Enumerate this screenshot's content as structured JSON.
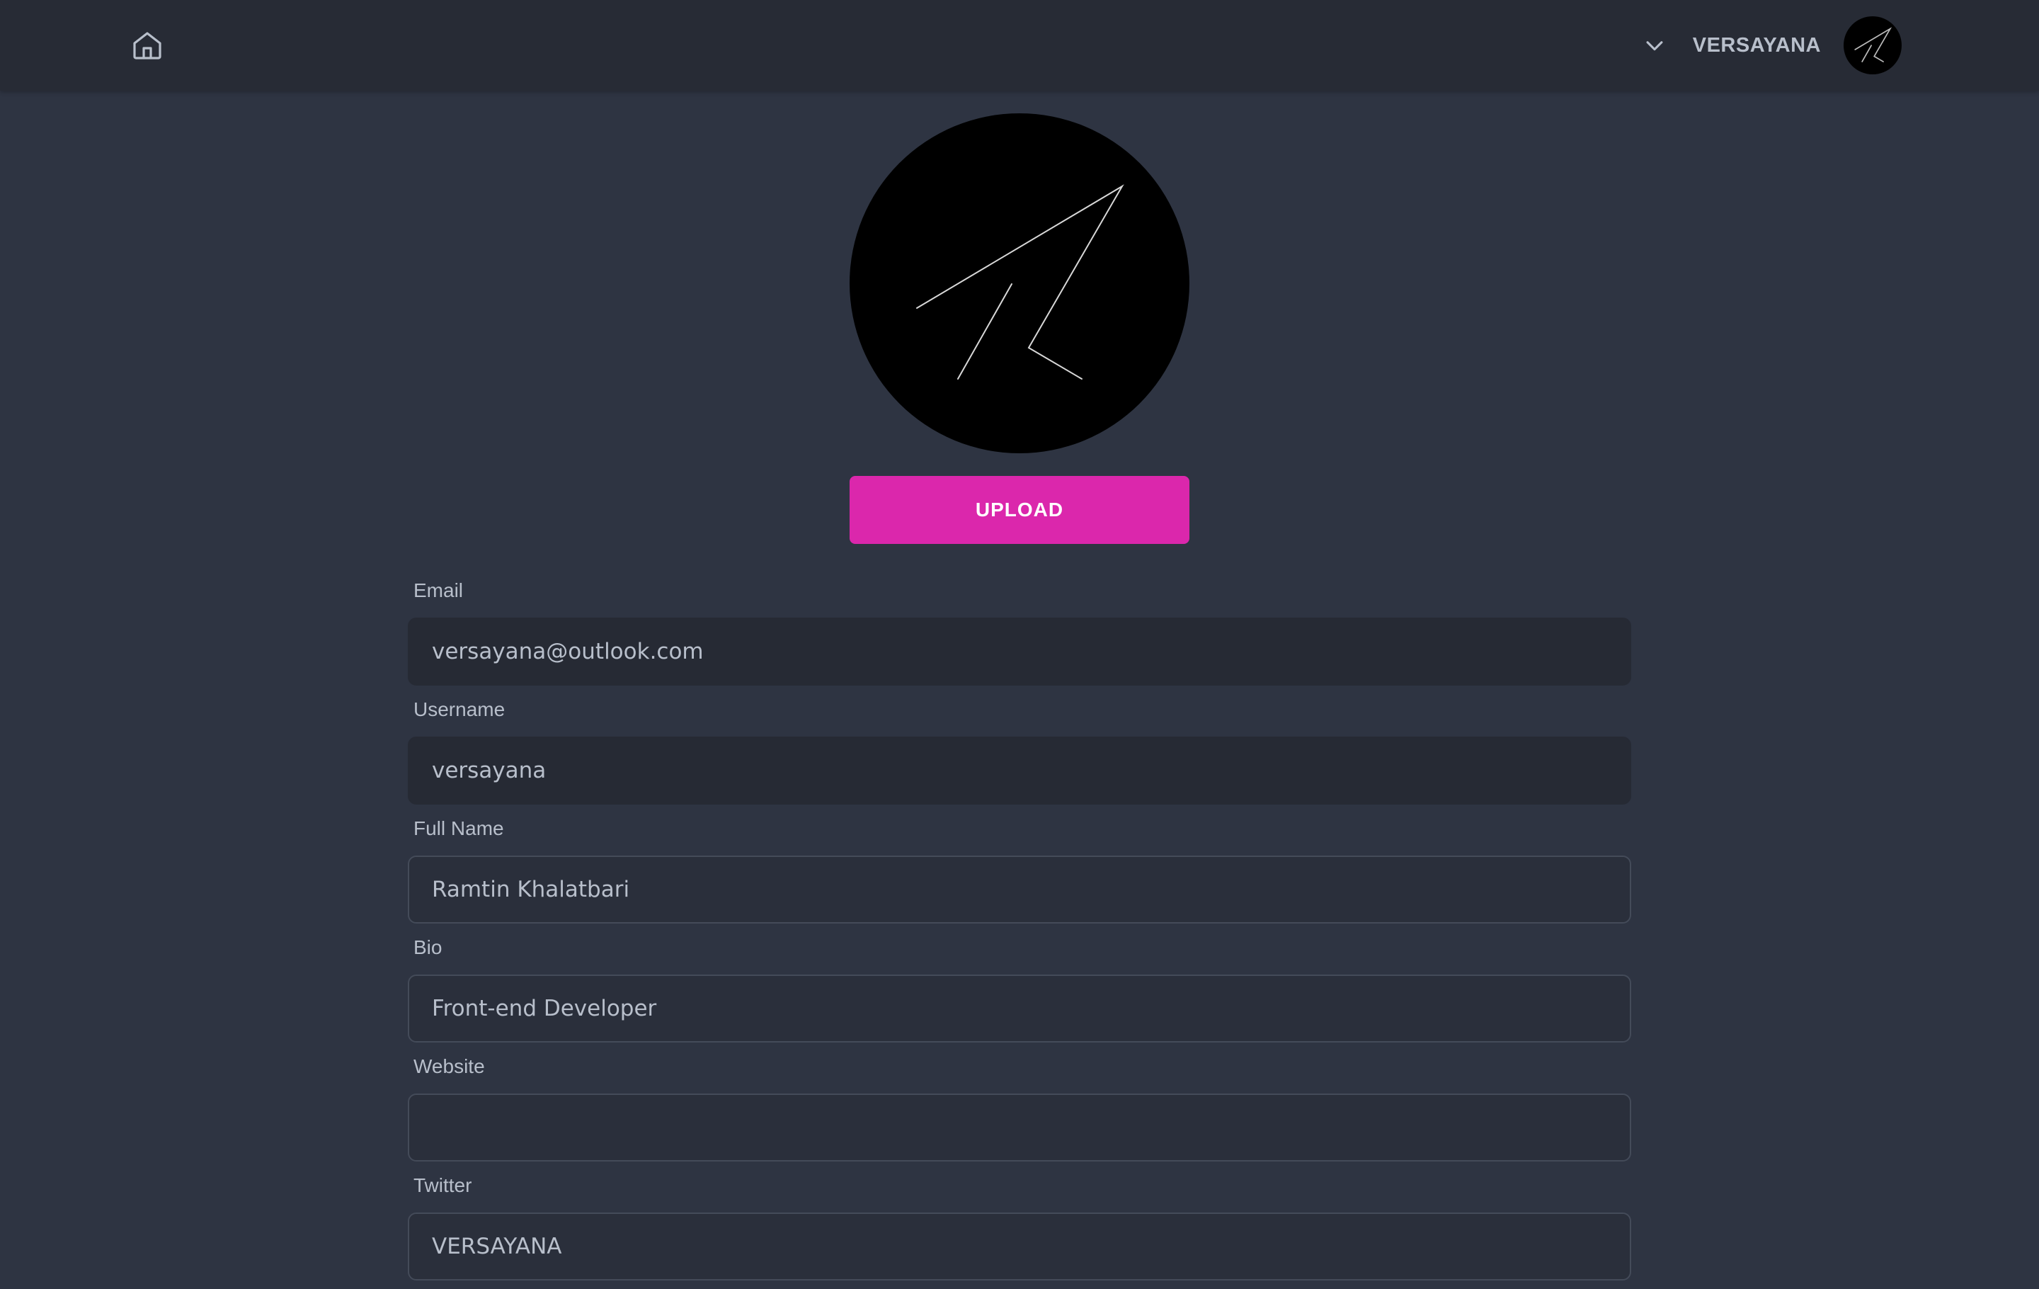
{
  "header": {
    "username": "VERSAYANA"
  },
  "profile": {
    "upload_label": "UPLOAD"
  },
  "form": {
    "fields": [
      {
        "label": "Email",
        "value": "versayana@outlook.com",
        "placeholder": ""
      },
      {
        "label": "Username",
        "value": "versayana",
        "placeholder": ""
      },
      {
        "label": "Full Name",
        "value": "Ramtin Khalatbari",
        "placeholder": ""
      },
      {
        "label": "Bio",
        "value": "Front-end Developer",
        "placeholder": ""
      },
      {
        "label": "Website",
        "value": "",
        "placeholder": ""
      },
      {
        "label": "Twitter",
        "value": "VERSAYANA",
        "placeholder": ""
      }
    ]
  },
  "colors": {
    "background": "#2e3442",
    "topbar": "#272b35",
    "accent": "#db27ac",
    "text": "#b8bfcb"
  },
  "icons": [
    "home-icon",
    "chevron-down-icon",
    "paper-plane-logo"
  ]
}
